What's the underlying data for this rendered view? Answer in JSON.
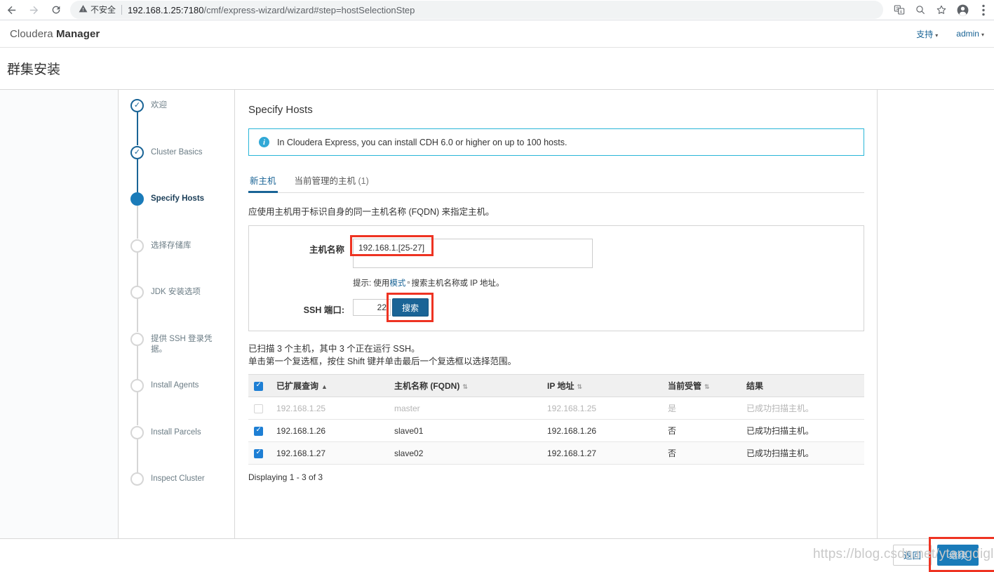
{
  "browser": {
    "back_icon": "back-arrow-icon",
    "forward_icon": "forward-arrow-icon",
    "reload_icon": "reload-icon",
    "warning_icon": "warning-triangle-icon",
    "security_label": "不安全",
    "url_host": "192.168.1.25:7180",
    "url_path": "/cmf/express-wizard/wizard#step=hostSelectionStep",
    "toolbar_icons": [
      "translate-icon",
      "search-icon",
      "star-bookmark-icon",
      "profile-avatar-icon",
      "kebab-menu-icon"
    ]
  },
  "app_header": {
    "brand_light": "Cloudera ",
    "brand_bold": "Manager",
    "support_label": "支持",
    "user_label": "admin"
  },
  "page": {
    "title": "群集安装"
  },
  "steps": [
    {
      "label": "欢迎",
      "state": "done"
    },
    {
      "label": "Cluster Basics",
      "state": "done"
    },
    {
      "label": "Specify Hosts",
      "state": "current"
    },
    {
      "label": "选择存储库",
      "state": "todo"
    },
    {
      "label": "JDK 安装选项",
      "state": "todo"
    },
    {
      "label": "提供 SSH 登录凭据。",
      "state": "todo"
    },
    {
      "label": "Install Agents",
      "state": "todo"
    },
    {
      "label": "Install Parcels",
      "state": "todo"
    },
    {
      "label": "Inspect Cluster",
      "state": "todo"
    }
  ],
  "main": {
    "section_title": "Specify Hosts",
    "info_banner": "In Cloudera Express, you can install CDH 6.0 or higher on up to 100 hosts.",
    "tabs": [
      {
        "label": "新主机",
        "active": true
      },
      {
        "label": "当前管理的主机",
        "count": "(1)",
        "active": false
      }
    ],
    "lead_text": "应使用主机用于标识自身的同一主机名称 (FQDN) 来指定主机。",
    "form": {
      "hostname_label": "主机名称",
      "hostname_value": "192.168.1.[25-27]",
      "hint_prefix": "提示: 使用",
      "hint_link": "模式",
      "hint_glyph": "▫",
      "hint_suffix": "搜索主机名称或 IP 地址。",
      "ssh_port_label": "SSH 端口:",
      "ssh_port_value": "22",
      "search_button": "搜索"
    },
    "scan_line1": "已扫描 3 个主机，其中 3 个正在运行 SSH。",
    "scan_line2": "单击第一个复选框，按住 Shift 键并单击最后一个复选框以选择范围。",
    "table": {
      "columns": [
        {
          "label": "已扩展查询",
          "sort": "asc"
        },
        {
          "label": "主机名称 (FQDN)",
          "sort": "both"
        },
        {
          "label": "IP 地址",
          "sort": "both"
        },
        {
          "label": "当前受管",
          "sort": "both"
        },
        {
          "label": "结果",
          "sort": "none"
        }
      ],
      "header_checkbox": "checked",
      "rows": [
        {
          "checked": false,
          "disabled": true,
          "query": "192.168.1.25",
          "fqdn": "master",
          "ip": "192.168.1.25",
          "managed": "是",
          "result": "已成功扫描主机。"
        },
        {
          "checked": true,
          "disabled": false,
          "query": "192.168.1.26",
          "fqdn": "slave01",
          "ip": "192.168.1.26",
          "managed": "否",
          "result": "已成功扫描主机。"
        },
        {
          "checked": true,
          "disabled": false,
          "query": "192.168.1.27",
          "fqdn": "slave02",
          "ip": "192.168.1.27",
          "managed": "否",
          "result": "已成功扫描主机。"
        }
      ],
      "displaying": "Displaying 1 - 3 of 3"
    }
  },
  "footer": {
    "back_label": "返回",
    "continue_label": "继续"
  },
  "watermark": "https://blog.csdn.net/ytangdigl",
  "colors": {
    "accent_blue": "#1a6496",
    "button_blue": "#1a7bb9",
    "info_border": "#29b6d8",
    "highlight_red": "#ee3322",
    "checkbox_blue": "#1e7fd4"
  }
}
